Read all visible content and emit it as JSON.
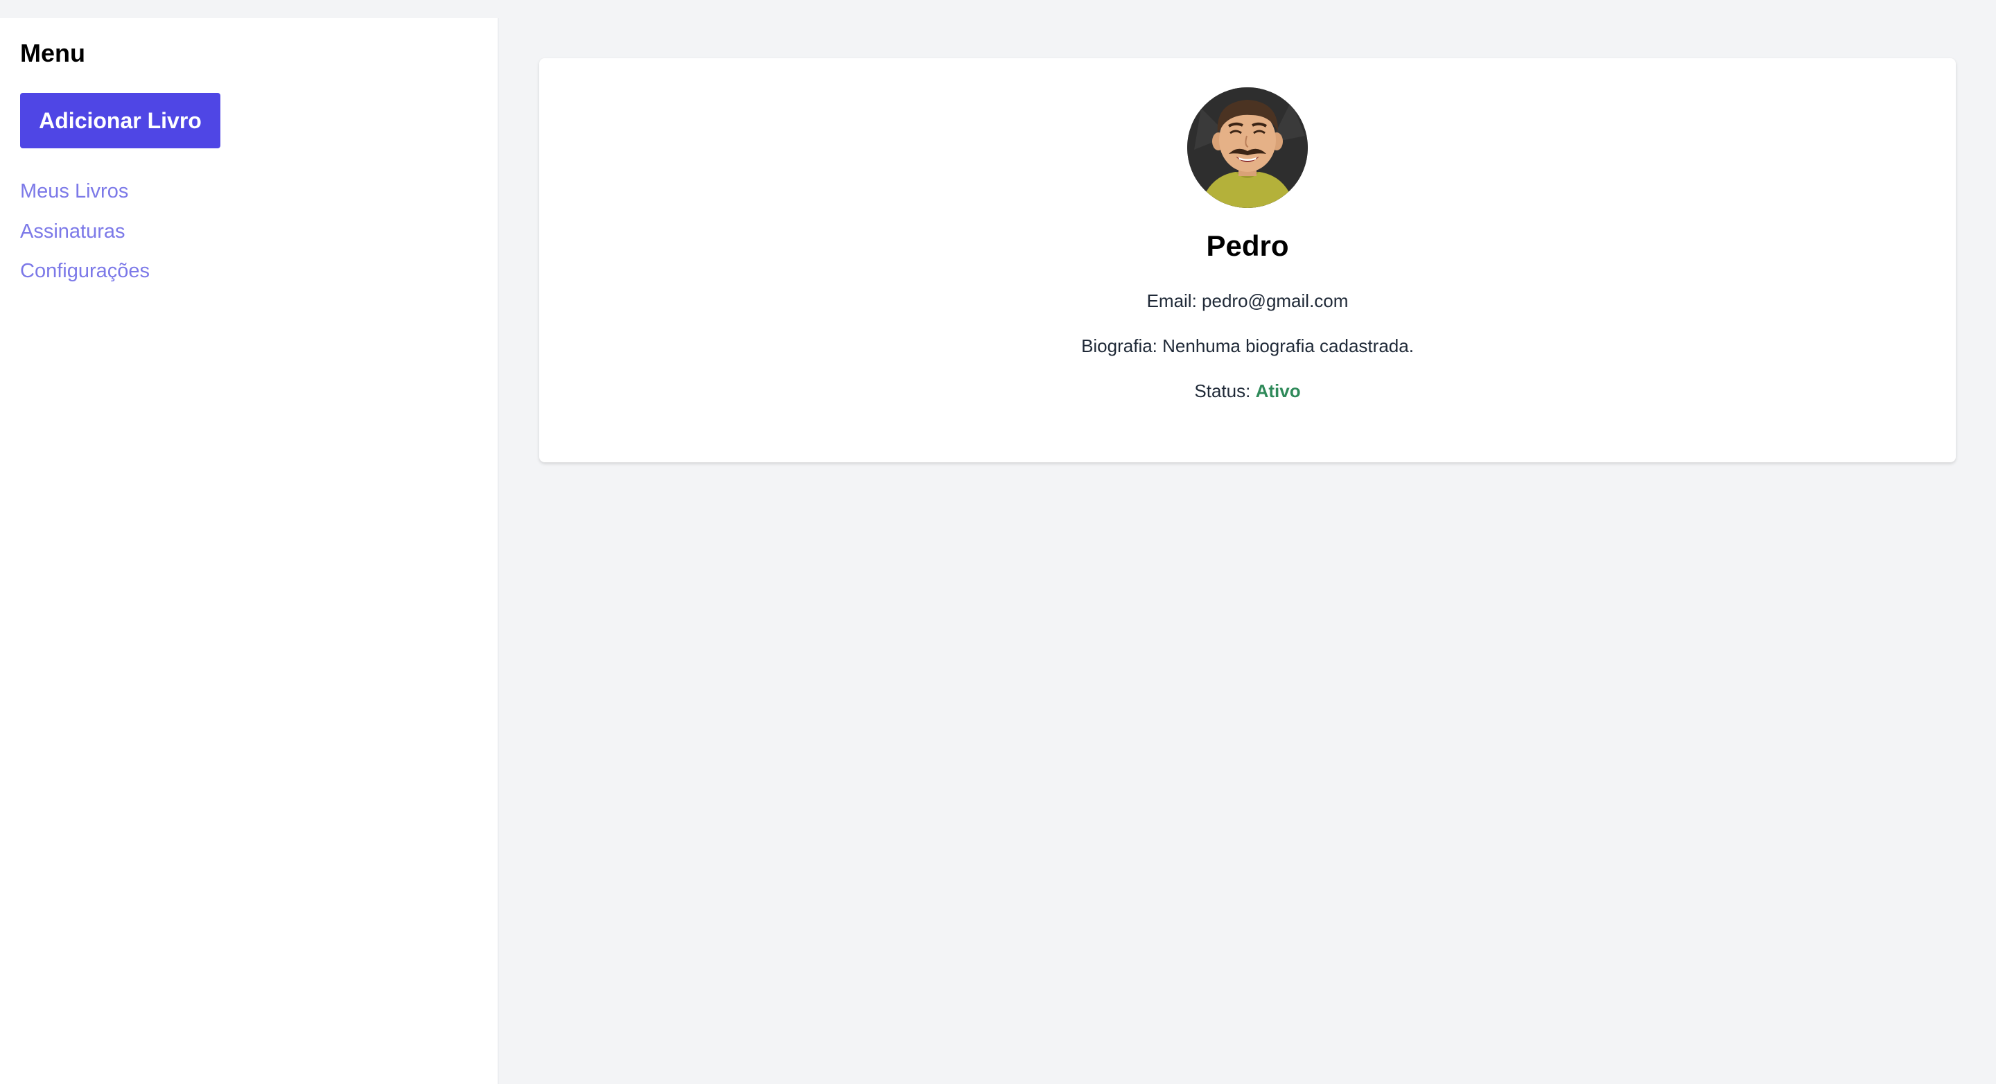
{
  "sidebar": {
    "title": "Menu",
    "add_button_label": "Adicionar Livro",
    "links": [
      {
        "label": "Meus Livros"
      },
      {
        "label": "Assinaturas"
      },
      {
        "label": "Configurações"
      }
    ]
  },
  "profile": {
    "avatar": "avatar-cartoon-man-mustache",
    "name": "Pedro",
    "email_label": "Email:",
    "email": "pedro@gmail.com",
    "bio_label": "Biografia:",
    "bio": "Nenhuma biografia cadastrada.",
    "status_label": "Status:",
    "status": "Ativo"
  },
  "colors": {
    "primary": "#4f46e5",
    "link": "#7c79e8",
    "status_active": "#2f8a5a",
    "background": "#f3f4f6"
  }
}
